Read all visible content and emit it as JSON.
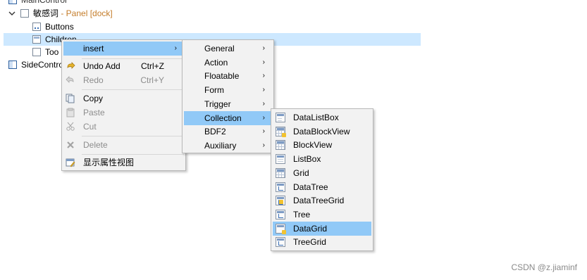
{
  "tree": {
    "partial_label": "MainControl",
    "sensitive_label": "敏感词",
    "sensitive_suffix": " - Panel [dock]",
    "buttons_label": "Buttons",
    "children_label": "Children",
    "tools_label": "Too",
    "side_label": "SideContro"
  },
  "context_menu": {
    "insert": "insert",
    "undo": "Undo Add",
    "undo_shortcut": "Ctrl+Z",
    "redo": "Redo",
    "redo_shortcut": "Ctrl+Y",
    "copy": "Copy",
    "paste": "Paste",
    "cut": "Cut",
    "delete": "Delete",
    "property_view": "显示属性视图",
    "arrow": "›"
  },
  "insert_menu": {
    "items": [
      "General",
      "Action",
      "Floatable",
      "Form",
      "Trigger",
      "Collection",
      "BDF2",
      "Auxiliary"
    ],
    "highlighted": "Collection"
  },
  "collection_menu": {
    "items": [
      "DataListBox",
      "DataBlockView",
      "BlockView",
      "ListBox",
      "Grid",
      "DataTree",
      "DataTreeGrid",
      "Tree",
      "DataGrid",
      "TreeGrid"
    ],
    "highlighted": "DataGrid"
  },
  "watermark": "CSDN @z.jiaminf",
  "colors": {
    "highlight": "#91c9f7",
    "selection": "#cde8ff",
    "panel_suffix": "#c47d2b",
    "menu_bg": "#f2f2f2"
  }
}
